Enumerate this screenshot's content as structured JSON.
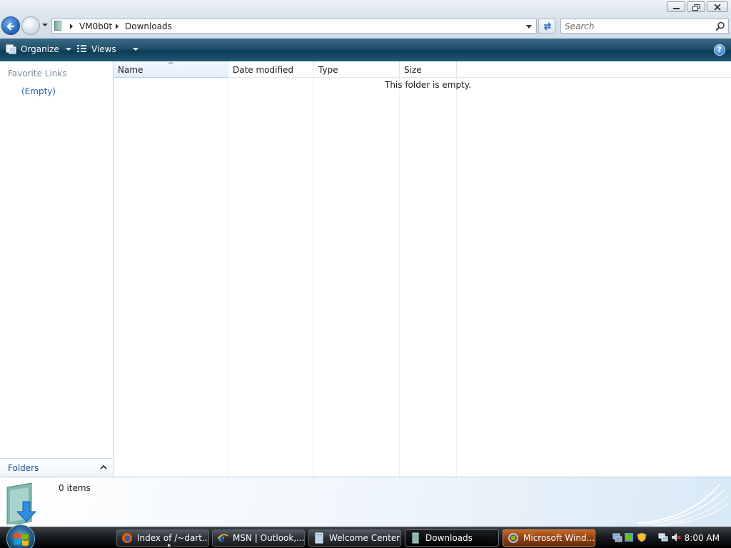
{
  "window": {
    "buttons": [
      "minimize",
      "maximize",
      "close"
    ]
  },
  "address": {
    "segments": [
      "VM0b0t",
      "Downloads"
    ],
    "search_placeholder": "Search"
  },
  "commandbar": {
    "organize": "Organize",
    "views": "Views",
    "help": "?"
  },
  "navpane": {
    "heading": "Favorite Links",
    "empty": "(Empty)",
    "folders": "Folders"
  },
  "filelist": {
    "columns": [
      "Name",
      "Date modified",
      "Type",
      "Size"
    ],
    "sorted_column": "Name",
    "empty_message": "This folder is empty."
  },
  "details": {
    "count": "0 items"
  },
  "taskbar": {
    "buttons": [
      {
        "label": "Index of /~dart...",
        "icon": "firefox-icon"
      },
      {
        "label": "MSN | Outlook,...",
        "icon": "internet-explorer-icon"
      },
      {
        "label": "Welcome Center",
        "icon": "window-icon"
      },
      {
        "label": "Downloads",
        "icon": "folder-icon",
        "active": true
      },
      {
        "label": "Microsoft Wind...",
        "icon": "windows-update-icon",
        "flashing": true
      }
    ],
    "clock": "8:00 AM"
  },
  "colors": {
    "commandbar": "#1d4e69",
    "link": "#2a5ca8",
    "taskbar": "#16191c",
    "flash": "#8f4010"
  }
}
